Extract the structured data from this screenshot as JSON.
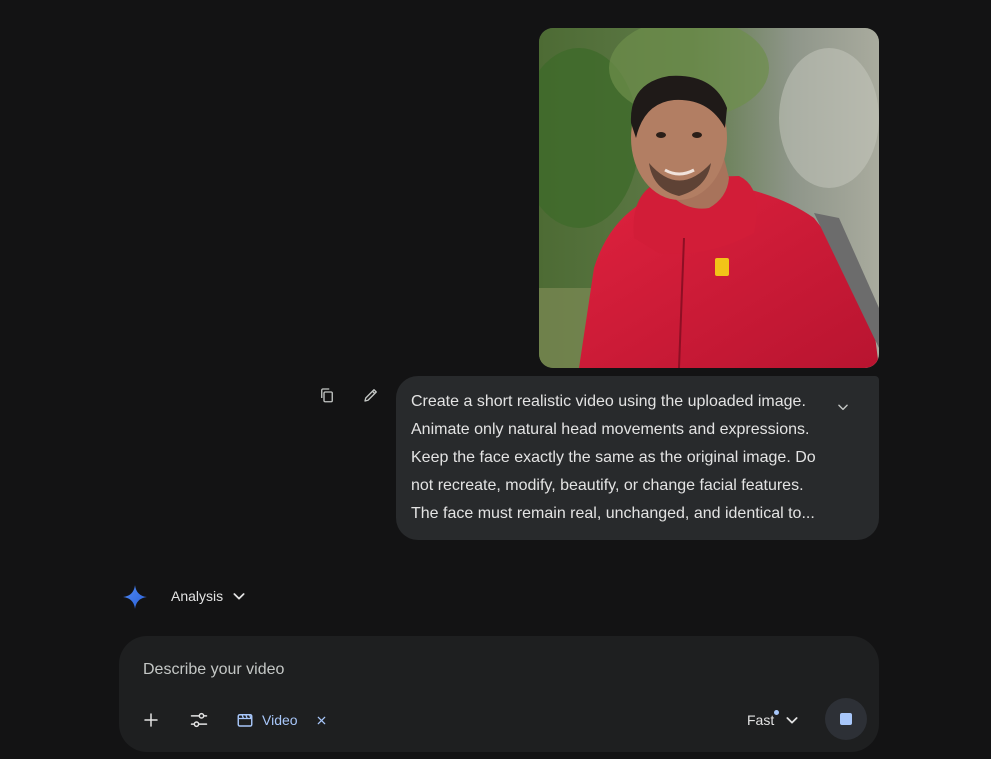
{
  "uploaded_image": {
    "alt": "",
    "logo_text": ""
  },
  "message_actions": {
    "copy_icon": "copy-icon",
    "edit_icon": "pencil-icon"
  },
  "prompt": {
    "text": "Create a short realistic video using the uploaded image.\nAnimate only natural head movements and expressions.\nKeep the face exactly the same as the original image. Do\nnot recreate, modify, beautify, or change facial features.\nThe face must remain real, unchanged, and identical to...",
    "expand_icon": "chevron-down-icon"
  },
  "response": {
    "model_label": "Analysis",
    "spark_icon": "gemini-spark-icon"
  },
  "composer": {
    "placeholder": "Describe your video",
    "value": "",
    "add_icon": "plus-icon",
    "tools_icon": "tune-icon",
    "video_chip_label": "Video",
    "video_chip_icon": "clapperboard-icon",
    "mode_label": "Fast",
    "stop_icon": "stop-icon"
  },
  "colors": {
    "background": "#131314",
    "bubble": "#282a2c",
    "composer": "#1e1f20",
    "accent": "#a8c7fa",
    "text": "#e3e3e3"
  }
}
